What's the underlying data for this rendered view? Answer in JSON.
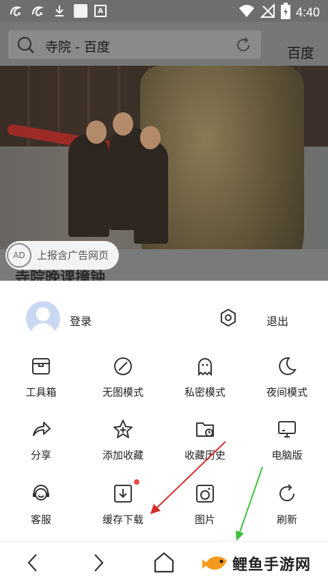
{
  "status_bar": {
    "time": "4:40",
    "icons": [
      "uc-browser-icon",
      "uc-browser-icon",
      "download-icon",
      "notification-square-icon",
      "a-box-icon",
      "wifi-icon",
      "no-signal-icon",
      "battery-icon"
    ]
  },
  "search": {
    "query": "寺院 - 百度",
    "action_label": "百度"
  },
  "content": {
    "ad_report_label": "上报含广告网页",
    "ad_badge_text": "AD",
    "headline_peek": "寺院晚课撞钟"
  },
  "menu": {
    "login_label": "登录",
    "logout_label": "退出",
    "items": [
      {
        "label": "工具箱",
        "icon": "toolbox-icon"
      },
      {
        "label": "无图模式",
        "icon": "no-image-icon"
      },
      {
        "label": "私密模式",
        "icon": "ghost-icon"
      },
      {
        "label": "夜间模式",
        "icon": "moon-icon"
      },
      {
        "label": "分享",
        "icon": "share-icon"
      },
      {
        "label": "添加收藏",
        "icon": "add-favorite-icon"
      },
      {
        "label": "收藏历史",
        "icon": "history-folder-icon"
      },
      {
        "label": "电脑版",
        "icon": "desktop-icon"
      },
      {
        "label": "客服",
        "icon": "customer-service-icon"
      },
      {
        "label": "缓存下载",
        "icon": "cache-download-icon"
      },
      {
        "label": "图片",
        "icon": "image-icon"
      },
      {
        "label": "刷新",
        "icon": "refresh-icon"
      }
    ]
  },
  "watermark": {
    "text": "鲤鱼手游网"
  },
  "colors": {
    "accent_red": "#e94b4b",
    "arrow_red": "#d42a2a",
    "arrow_green": "#3cc03c",
    "logo_orange": "#f59a1e"
  }
}
